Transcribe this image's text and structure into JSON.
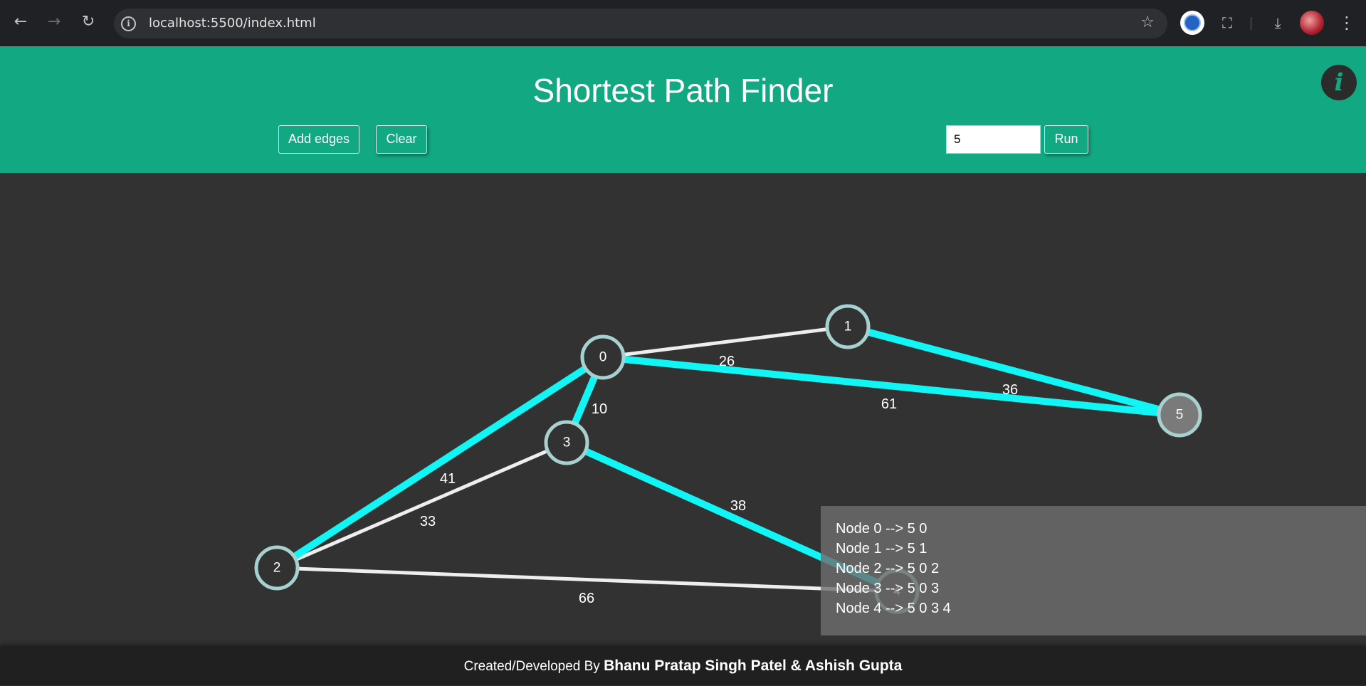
{
  "browser": {
    "url": "localhost:5500/index.html",
    "icons": {
      "back": "back-arrow-icon",
      "forward": "forward-arrow-icon",
      "reload": "reload-icon",
      "info": "site-info-icon",
      "bookmark": "bookmark-star-icon",
      "extensions": "puzzle-icon",
      "download": "download-icon",
      "menu": "kebab-menu-icon"
    }
  },
  "header": {
    "title": "Shortest Path Finder",
    "add_edges_label": "Add edges",
    "clear_label": "Clear",
    "source_value": "5",
    "run_label": "Run",
    "info_glyph": "i",
    "accent": "#12a882"
  },
  "graph": {
    "nodes": [
      {
        "id": "0",
        "label": "0",
        "source": false
      },
      {
        "id": "1",
        "label": "1",
        "source": false
      },
      {
        "id": "2",
        "label": "2",
        "source": false
      },
      {
        "id": "3",
        "label": "3",
        "source": false
      },
      {
        "id": "4",
        "label": "4",
        "source": false
      },
      {
        "id": "5",
        "label": "5",
        "source": true
      }
    ],
    "edges": [
      {
        "from": "0",
        "to": "1",
        "weight": "26",
        "on_path": false
      },
      {
        "from": "1",
        "to": "5",
        "weight": "36",
        "on_path": true
      },
      {
        "from": "0",
        "to": "5",
        "weight": "61",
        "on_path": true
      },
      {
        "from": "0",
        "to": "3",
        "weight": "10",
        "on_path": true
      },
      {
        "from": "0",
        "to": "2",
        "weight": "41",
        "on_path": true
      },
      {
        "from": "3",
        "to": "2",
        "weight": "33",
        "on_path": false
      },
      {
        "from": "3",
        "to": "4",
        "weight": "38",
        "on_path": true
      },
      {
        "from": "2",
        "to": "4",
        "weight": "66",
        "on_path": false
      }
    ],
    "colors": {
      "path_edge": "#11f5f5",
      "normal_edge": "#eeeeee",
      "node_fill": "#323232",
      "source_fill": "#7a7a7a",
      "node_stroke": "#a7d1cf"
    }
  },
  "results": {
    "lines": [
      "Node 0 --> 5 0",
      "Node 1 --> 5 1",
      "Node 2 --> 5 0 2",
      "Node 3 --> 5 0 3",
      "Node 4 --> 5 0 3 4"
    ]
  },
  "footer": {
    "prefix": "Created/Developed By ",
    "authors": "Bhanu Pratap Singh Patel & Ashish Gupta"
  }
}
